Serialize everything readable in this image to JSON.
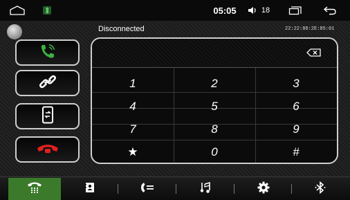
{
  "status_bar": {
    "time": "05:05",
    "volume": "18"
  },
  "bluetooth": {
    "connection_status": "Disconnected",
    "device_address": "22:22:88:2E:85:01"
  },
  "keypad": {
    "keys": [
      "1",
      "2",
      "3",
      "4",
      "5",
      "6",
      "7",
      "8",
      "9",
      "★",
      "0",
      "#"
    ]
  },
  "colors": {
    "call_green": "#3cb043",
    "hangup_red": "#e02020",
    "active_tab": "#3b7a2a"
  },
  "side_buttons": [
    "call-icon",
    "link-icon",
    "phone-transfer-icon",
    "hangup-icon"
  ],
  "bottom_tabs": [
    "dialpad-icon",
    "contacts-icon",
    "call-log-icon",
    "music-icon",
    "settings-icon",
    "bluetooth-icon"
  ]
}
